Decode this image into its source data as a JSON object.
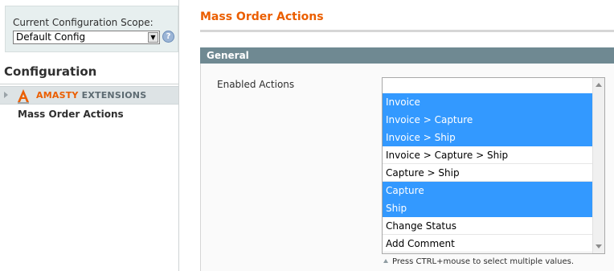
{
  "scope": {
    "label": "Current Configuration Scope:",
    "selected": "Default Config"
  },
  "sidebar": {
    "title": "Configuration",
    "group": {
      "label_part1": "AMASTY",
      "label_part2": "EXTENSIONS",
      "icon": "amasty-logo-icon"
    },
    "items": [
      {
        "label": "Mass Order Actions"
      }
    ]
  },
  "main": {
    "title": "Mass Order Actions",
    "section": {
      "title": "General",
      "field": {
        "label": "Enabled Actions",
        "options": [
          {
            "label": "",
            "selected": false
          },
          {
            "label": "Invoice",
            "selected": true
          },
          {
            "label": "Invoice > Capture",
            "selected": true
          },
          {
            "label": "Invoice > Ship",
            "selected": true
          },
          {
            "label": "Invoice > Capture > Ship",
            "selected": false
          },
          {
            "label": "Capture > Ship",
            "selected": false
          },
          {
            "label": "Capture",
            "selected": true
          },
          {
            "label": "Ship",
            "selected": true
          },
          {
            "label": "Change Status",
            "selected": false
          },
          {
            "label": "Add Comment",
            "selected": false
          }
        ],
        "note": "Press CTRL+mouse to select multiple values."
      }
    }
  },
  "colors": {
    "accent": "#eb5e00",
    "selection": "#3399ff",
    "section_header": "#6f8992"
  }
}
